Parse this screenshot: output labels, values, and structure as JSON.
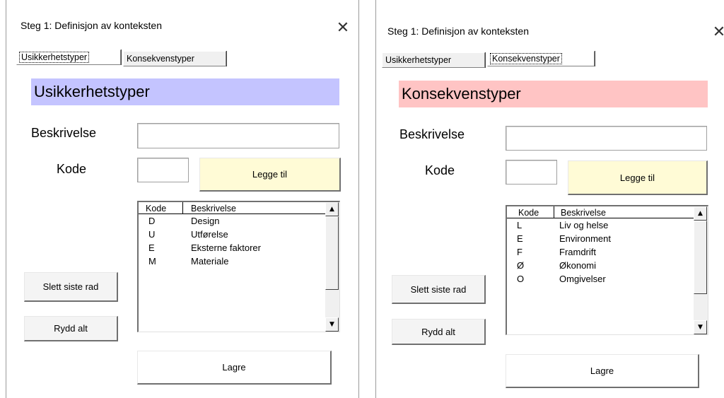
{
  "dialogs": [
    {
      "title": "Steg 1: Definisjon av konteksten",
      "close_glyph": "✕",
      "tabs": [
        {
          "label": "Usikkerhetstyper",
          "active": true
        },
        {
          "label": "Konsekvenstyper",
          "active": false
        }
      ],
      "heading": "Usikkerhetstyper",
      "heading_color": "#c4c4ff",
      "beskrivelse_label": "Beskrivelse",
      "beskrivelse_value": "",
      "kode_label": "Kode",
      "kode_value": "",
      "add_button": "Legge til",
      "list": {
        "headers": {
          "code": "Kode",
          "desc": "Beskrivelse"
        },
        "rows": [
          {
            "code": "D",
            "desc": "Design"
          },
          {
            "code": "U",
            "desc": "Utførelse"
          },
          {
            "code": "E",
            "desc": "Eksterne faktorer"
          },
          {
            "code": "M",
            "desc": "Materiale"
          }
        ]
      },
      "delete_last_button": "Slett siste rad",
      "clear_all_button": "Rydd alt",
      "save_button": "Lagre"
    },
    {
      "title": "Steg 1: Definisjon av konteksten",
      "close_glyph": "✕",
      "tabs": [
        {
          "label": "Usikkerhetstyper",
          "active": false
        },
        {
          "label": "Konsekvenstyper",
          "active": true
        }
      ],
      "heading": "Konsekvenstyper",
      "heading_color": "#ffc4c4",
      "beskrivelse_label": "Beskrivelse",
      "beskrivelse_value": "",
      "kode_label": "Kode",
      "kode_value": "",
      "add_button": "Legge til",
      "list": {
        "headers": {
          "code": "Kode",
          "desc": "Beskrivelse"
        },
        "rows": [
          {
            "code": "L",
            "desc": "Liv og helse"
          },
          {
            "code": "E",
            "desc": "Environment"
          },
          {
            "code": "F",
            "desc": "Framdrift"
          },
          {
            "code": "Ø",
            "desc": "Økonomi"
          },
          {
            "code": "O",
            "desc": "Omgivelser"
          }
        ]
      },
      "delete_last_button": "Slett siste rad",
      "clear_all_button": "Rydd alt",
      "save_button": "Lagre"
    }
  ],
  "icons": {
    "scroll_up": "▲",
    "scroll_down": "▼"
  }
}
